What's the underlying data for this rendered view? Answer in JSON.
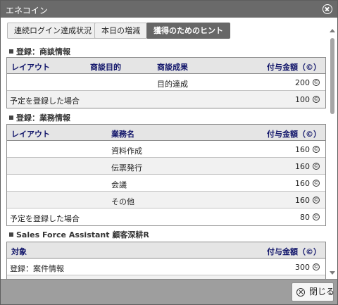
{
  "window": {
    "title": "エネコイン"
  },
  "tabs": [
    {
      "label": "連続ログイン達成状況",
      "active": false
    },
    {
      "label": "本日の増減",
      "active": false
    },
    {
      "label": "獲得のためのヒント",
      "active": true
    }
  ],
  "coin_symbol": "©",
  "sections": [
    {
      "title": "登録：商談情報",
      "headers": [
        "レイアウト",
        "商談目的",
        "商談成果",
        "付与金額（©）"
      ],
      "rows": [
        {
          "c1": "",
          "c2": "",
          "c3": "目的達成",
          "amount": "200"
        },
        {
          "c1": "予定を登録した場合",
          "c2": "",
          "c3": "",
          "amount": "100"
        }
      ]
    },
    {
      "title": "登録：業務情報",
      "headers": [
        "レイアウト",
        "業務名",
        "付与金額（©）"
      ],
      "rows": [
        {
          "c1": "",
          "c2": "資料作成",
          "amount": "160"
        },
        {
          "c1": "",
          "c2": "伝票発行",
          "amount": "160"
        },
        {
          "c1": "",
          "c2": "会議",
          "amount": "160"
        },
        {
          "c1": "",
          "c2": "その他",
          "amount": "160"
        },
        {
          "c1": "予定を登録した場合",
          "c2": "",
          "amount": "80"
        }
      ]
    },
    {
      "title": "Sales Force Assistant 顧客深耕R",
      "headers": [
        "対象",
        "付与金額（©）"
      ],
      "rows": [
        {
          "c1": "登録：案件情報",
          "amount": "300"
        }
      ]
    }
  ],
  "footer": {
    "close_label": "閉じる"
  },
  "colors": {
    "titlebar": "#6a6a6a",
    "header_text": "#11156a",
    "active_tab": "#676767",
    "footer": "#9e9e9e"
  }
}
